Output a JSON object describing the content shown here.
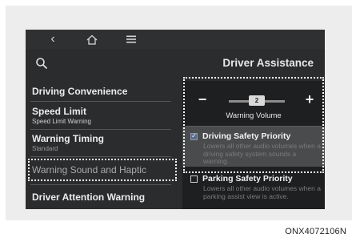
{
  "navbar": {
    "back_icon": "chevron-left-icon",
    "back_glyph": "‹",
    "home_icon": "home-icon",
    "home_glyph": "⌂",
    "menu_icon": "menu-icon",
    "menu_glyph": "≡"
  },
  "header": {
    "search_icon": "search-icon",
    "title": "Driver Assistance"
  },
  "menu": {
    "items": [
      {
        "label": "Driving Convenience",
        "sub": ""
      },
      {
        "label": "Speed Limit",
        "sub": "Speed Limit Warning"
      },
      {
        "label": "Warning Timing",
        "sub": "Standard"
      },
      {
        "label": "Warning Sound and Haptic",
        "sub": ""
      },
      {
        "label": "Driver Attention Warning",
        "sub": ""
      }
    ]
  },
  "panel": {
    "volume": {
      "minus": "−",
      "plus": "+",
      "value": "2",
      "level_fraction": 0.5,
      "label": "Warning Volume"
    },
    "options": [
      {
        "title": "Driving Safety Priority",
        "checked": true,
        "description": "Lowers all other audio volumes when a driving safety system sounds a warning."
      },
      {
        "title": "Parking Safety Priority",
        "checked": false,
        "description": "Lowers all other audio volumes when a parking assist view is active."
      }
    ]
  },
  "caption": "ONX4072106N",
  "colors": {
    "screen_bg": "#2b2c2e",
    "panel_bg": "#1e1f21",
    "highlight_row": "#4a4b4d",
    "outline": "#ffffff"
  }
}
